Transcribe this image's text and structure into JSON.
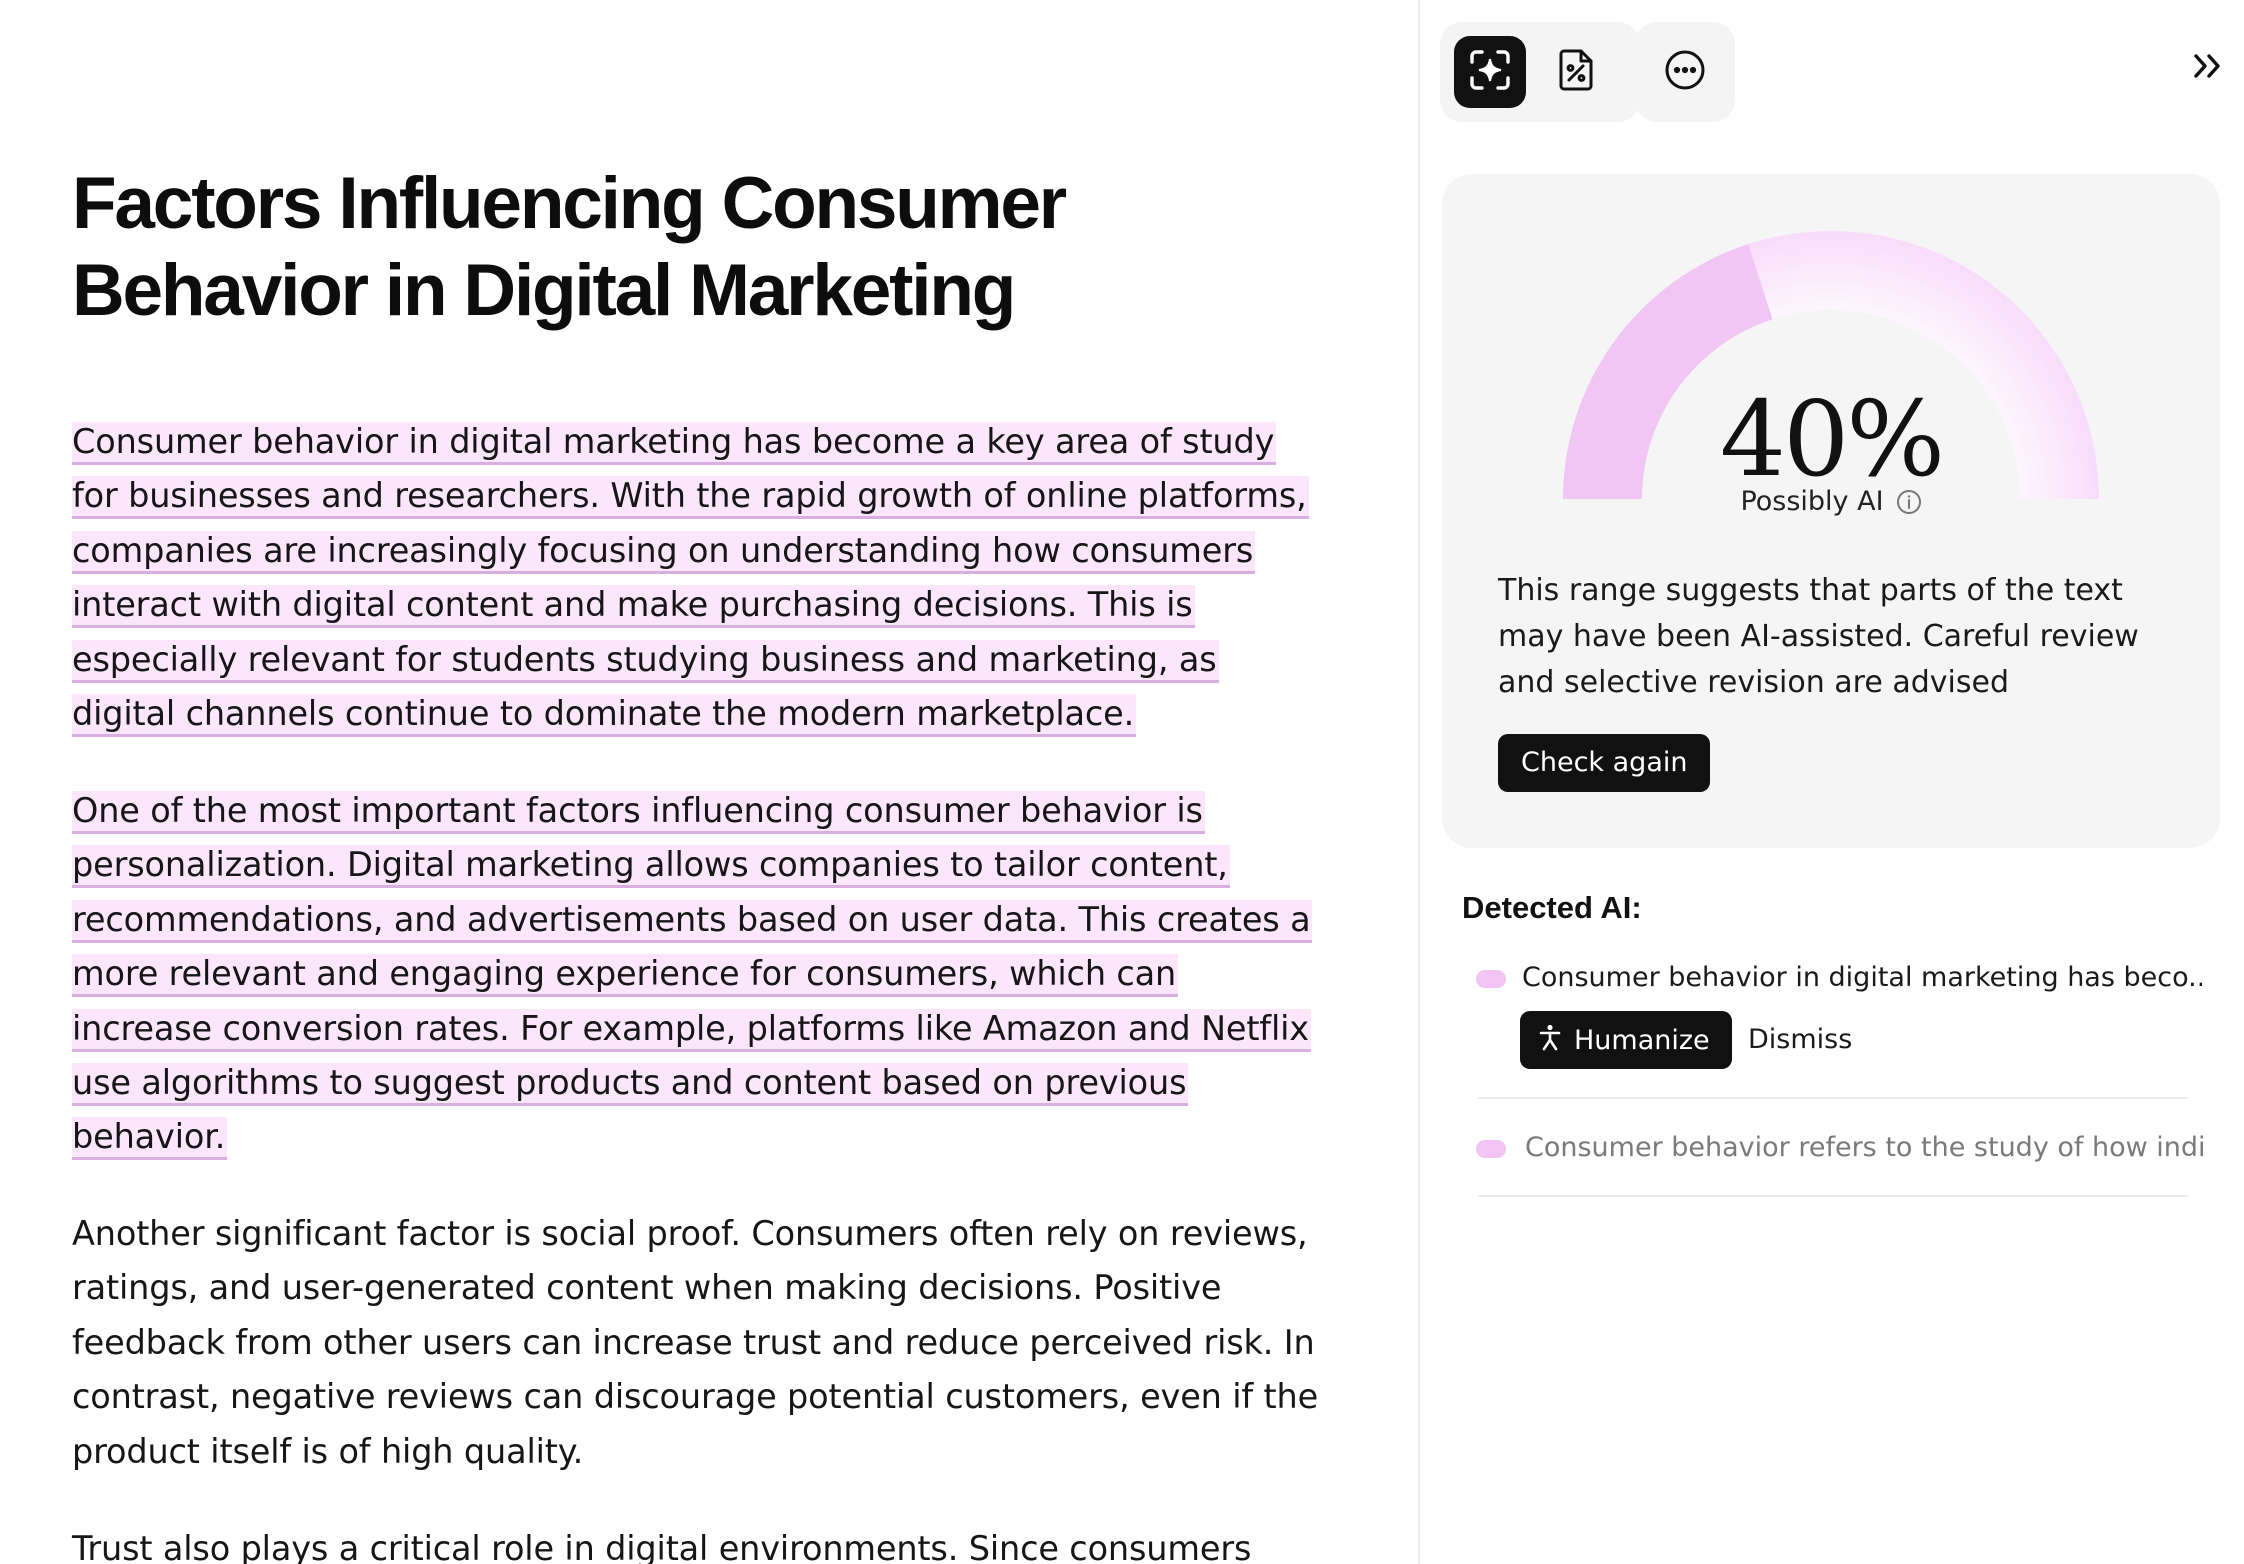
{
  "document": {
    "title_line1": "Factors Influencing Consumer",
    "title_line2": "Behavior in Digital Marketing",
    "paragraphs": [
      {
        "lines": [
          "Consumer behavior in digital marketing has become a key area of study",
          "for businesses and researchers. With the rapid growth of online platforms,",
          "companies are increasingly focusing on understanding how consumers",
          "interact with digital content and make purchasing decisions. This is",
          "especially relevant for students studying business and marketing, as",
          "digital channels continue to dominate the modern marketplace."
        ],
        "highlighted": true
      },
      {
        "lines": [
          "One of the most important factors influencing consumer behavior is",
          "personalization. Digital marketing allows companies to tailor content,",
          "recommendations, and advertisements based on user data. This creates a",
          "more relevant and engaging experience for consumers, which can",
          "increase conversion rates. For example, platforms like Amazon and Netflix",
          "use algorithms to suggest products and content based on previous",
          "behavior."
        ],
        "highlighted": true
      },
      {
        "lines": [
          "Another significant factor is social proof. Consumers often rely on reviews,",
          "ratings, and user-generated content when making decisions. Positive",
          "feedback from other users can increase trust and reduce perceived risk. In",
          "contrast, negative reviews can discourage potential customers, even if the",
          "product itself is of high quality."
        ],
        "highlighted": false
      },
      {
        "lines": [
          "Trust also plays a critical role in digital environments. Since consumers"
        ],
        "highlighted": false
      }
    ]
  },
  "toolbar": {
    "buttons": [
      {
        "icon": "ai-scan-icon",
        "active": true
      },
      {
        "icon": "document-percent-icon",
        "active": false
      },
      {
        "icon": "more-options-icon",
        "active": false
      }
    ],
    "collapse_icon": "double-chevron-right-icon"
  },
  "score": {
    "percent_value": 40,
    "percent_text": "40%",
    "label": "Possibly AI",
    "description": "This range suggests that parts of the text may have been AI-assisted. Careful review and selective revision are advised",
    "check_again_label": "Check again"
  },
  "detected": {
    "title": "Detected AI:",
    "items": [
      {
        "text": "Consumer behavior in digital marketing has beco...",
        "expanded": true
      },
      {
        "text": "Consumer behavior refers to the study of how indi...",
        "expanded": false
      }
    ],
    "humanize_label": "Humanize",
    "dismiss_label": "Dismiss"
  },
  "colors": {
    "highlight_bg": "#fbe6fb",
    "highlight_underline": "#d9aee0",
    "gauge_filled": "#f1c6f4",
    "gauge_track": "#fbe8fc",
    "dark": "#111111",
    "dot": "#f3c4f3"
  }
}
